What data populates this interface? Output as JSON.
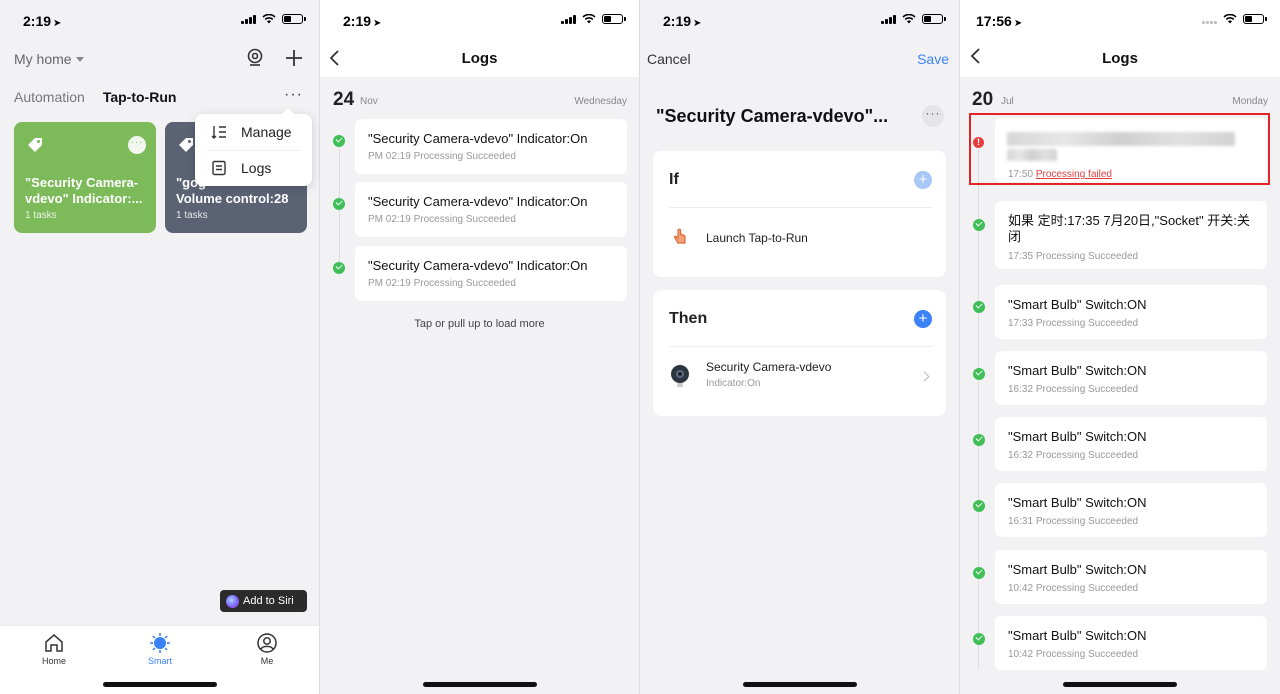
{
  "panel1": {
    "status_time": "2:19",
    "home_label": "My home",
    "tabs": [
      {
        "label": "Automation"
      },
      {
        "label": "Tap-to-Run"
      }
    ],
    "more_label": "···",
    "cards": [
      {
        "title": "\"Security Camera-vdevo\" Indicator:...",
        "tasks": "1 tasks",
        "color": "#7cba5a"
      },
      {
        "title": "\"gog...ggg\" Volume control:28",
        "title_visible": "\"gog",
        "title_line2": "Volume control:28",
        "tasks": "1 tasks",
        "color": "#5a6273"
      }
    ],
    "menu": [
      {
        "label": "Manage",
        "icon": "sort-icon"
      },
      {
        "label": "Logs",
        "icon": "document-icon"
      }
    ],
    "siri_label": "Add to Siri",
    "tabbar": [
      {
        "label": "Home",
        "icon": "home-icon"
      },
      {
        "label": "Smart",
        "icon": "sun-icon"
      },
      {
        "label": "Me",
        "icon": "user-icon"
      }
    ],
    "accent": "#3b82f6"
  },
  "panel2": {
    "status_time": "2:19",
    "title": "Logs",
    "date_day": "24",
    "date_month": "Nov",
    "date_weekday": "Wednesday",
    "logs": [
      {
        "text": "\"Security Camera-vdevo\" Indicator:On",
        "time": "PM 02:19",
        "status": "Processing Succeeded"
      },
      {
        "text": "\"Security Camera-vdevo\" Indicator:On",
        "time": "PM 02:19",
        "status": "Processing Succeeded"
      },
      {
        "text": "\"Security Camera-vdevo\" Indicator:On",
        "time": "PM 02:19",
        "status": "Processing Succeeded"
      }
    ],
    "load_more": "Tap or pull up to load more"
  },
  "panel3": {
    "status_time": "2:19",
    "cancel": "Cancel",
    "save": "Save",
    "title": "\"Security Camera-vdevo\"...",
    "if_heading": "If",
    "if_row": "Launch Tap-to-Run",
    "then_heading": "Then",
    "then_row": "Security Camera-vdevo",
    "then_sub": "Indicator:On"
  },
  "panel4": {
    "status_time": "17:56",
    "title": "Logs",
    "date_day": "20",
    "date_month": "Jul",
    "date_weekday": "Monday",
    "failed": {
      "time": "17:50",
      "status": "Processing failed"
    },
    "logs": [
      {
        "text": "如果 定时:17:35 7月20日,\"Socket\" 开关:关闭",
        "time": "17:35",
        "status": "Processing Succeeded"
      },
      {
        "text": "\"Smart Bulb\" Switch:ON",
        "time": "17:33",
        "status": "Processing Succeeded"
      },
      {
        "text": "\"Smart Bulb\" Switch:ON",
        "time": "16:32",
        "status": "Processing Succeeded"
      },
      {
        "text": "\"Smart Bulb\" Switch:ON",
        "time": "16:32",
        "status": "Processing Succeeded"
      },
      {
        "text": "\"Smart Bulb\" Switch:ON",
        "time": "16:31",
        "status": "Processing Succeeded"
      },
      {
        "text": "\"Smart Bulb\" Switch:ON",
        "time": "10:42",
        "status": "Processing Succeeded"
      },
      {
        "text": "\"Smart Bulb\" Switch:ON",
        "time": "10:42",
        "status": "Processing Succeeded"
      }
    ],
    "success_color": "#3fbf55",
    "error_color": "#e53e3e"
  }
}
